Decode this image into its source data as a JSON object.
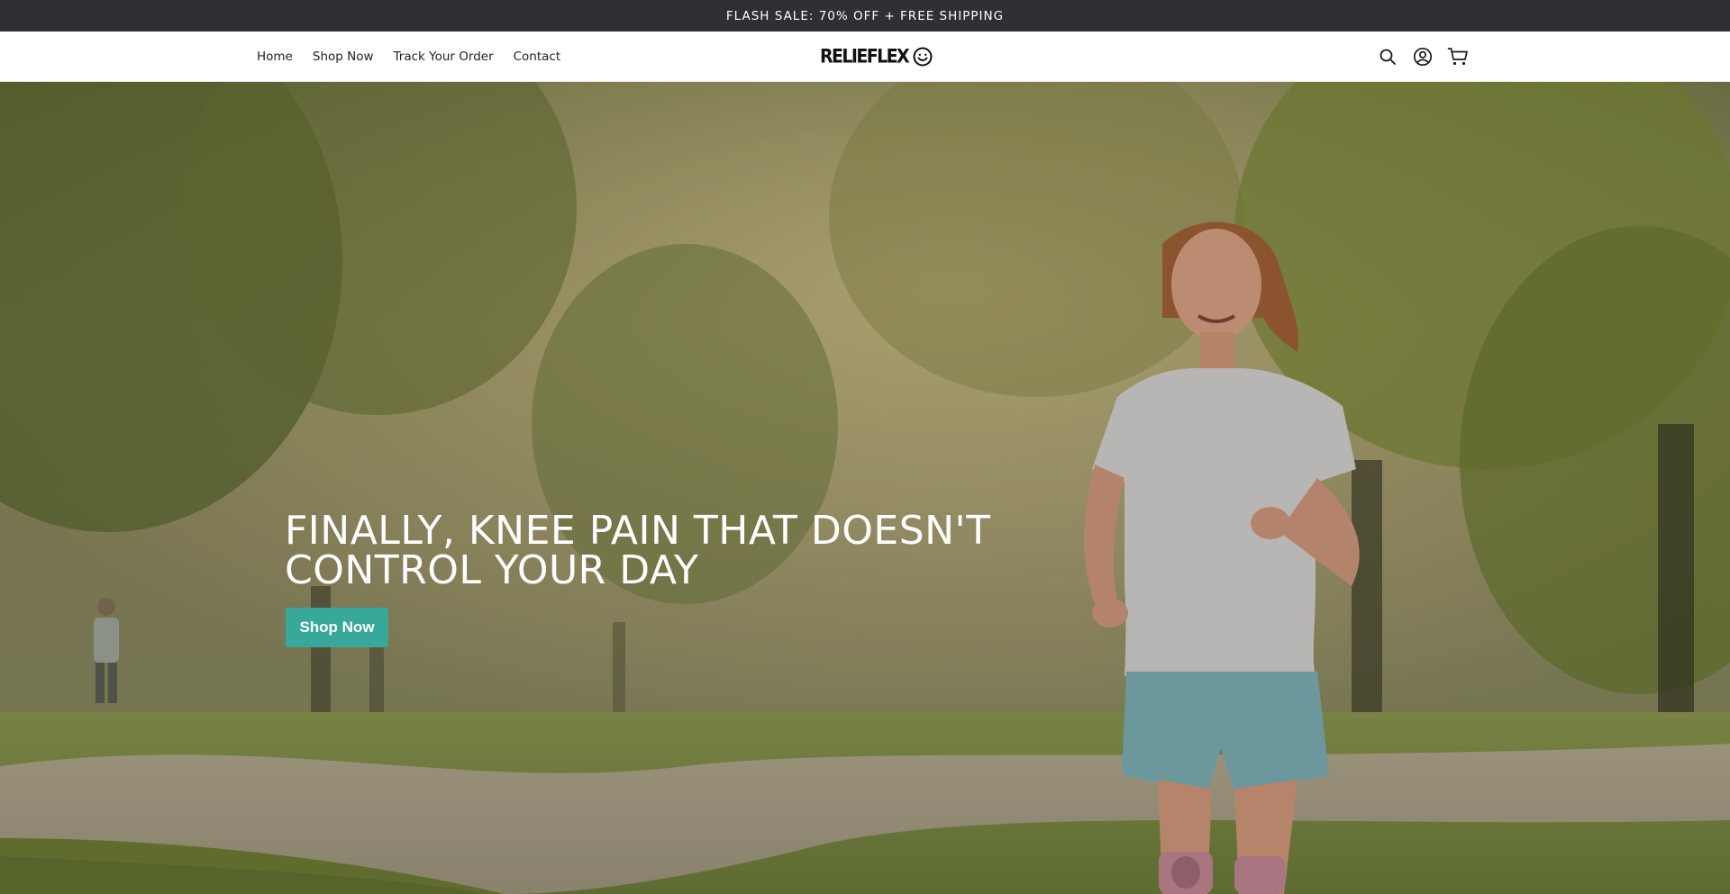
{
  "announcement": {
    "text": "FLASH SALE: 70% OFF + FREE SHIPPING"
  },
  "header": {
    "nav": [
      {
        "label": "Home"
      },
      {
        "label": "Shop Now"
      },
      {
        "label": "Track Your Order"
      },
      {
        "label": "Contact"
      }
    ],
    "logo_text": "RELIEFLEX",
    "icons": [
      "search-icon",
      "account-icon",
      "cart-icon"
    ]
  },
  "hero": {
    "title": "FINALLY, KNEE PAIN THAT DOESN'T CONTROL YOUR DAY",
    "button_label": "Shop Now",
    "image_subject": "woman jogging in a park wearing knee braces",
    "colors": {
      "button": "#37a89a",
      "announcement_bg": "#2e3035"
    }
  }
}
